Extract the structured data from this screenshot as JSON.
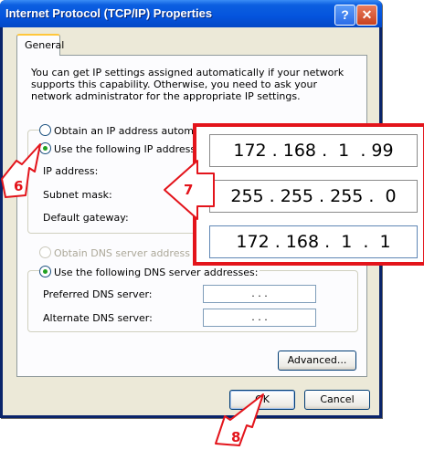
{
  "window": {
    "title": "Internet Protocol (TCP/IP) Properties",
    "help_label": "?",
    "close_label": "✕"
  },
  "tabs": [
    {
      "label": "General"
    }
  ],
  "intro_text": "You can get IP settings assigned automatically if your network supports this capability. Otherwise, you need to ask your network administrator for the appropriate IP settings.",
  "ip": {
    "auto_label": "Obtain an IP address automatic",
    "manual_label": "Use the following IP address:",
    "selected": "manual",
    "fields": [
      {
        "label": "IP address:",
        "value": ""
      },
      {
        "label": "Subnet mask:",
        "value": ""
      },
      {
        "label": "Default gateway:",
        "value": ""
      }
    ]
  },
  "dns": {
    "auto_label": "Obtain DNS server address auto",
    "manual_label": "Use the following DNS server addresses:",
    "selected": "manual",
    "fields": [
      {
        "label": "Preferred DNS server:",
        "value": ".       .       ."
      },
      {
        "label": "Alternate DNS server:",
        "value": ".       .       ."
      }
    ]
  },
  "buttons": {
    "advanced": "Advanced...",
    "ok": "OK",
    "cancel": "Cancel"
  },
  "zoom_fields": {
    "ip_address": "172 . 168 .  1  . 99",
    "subnet_mask": "255 . 255 . 255 .  0",
    "default_gateway": "172 . 168 .  1  .  1"
  },
  "callouts": {
    "step6": "6",
    "step7": "7",
    "step8": "8"
  },
  "colors": {
    "title_blue": "#0454dd",
    "dialog_bg": "#ece9d8",
    "callout_red": "#e3141b"
  }
}
